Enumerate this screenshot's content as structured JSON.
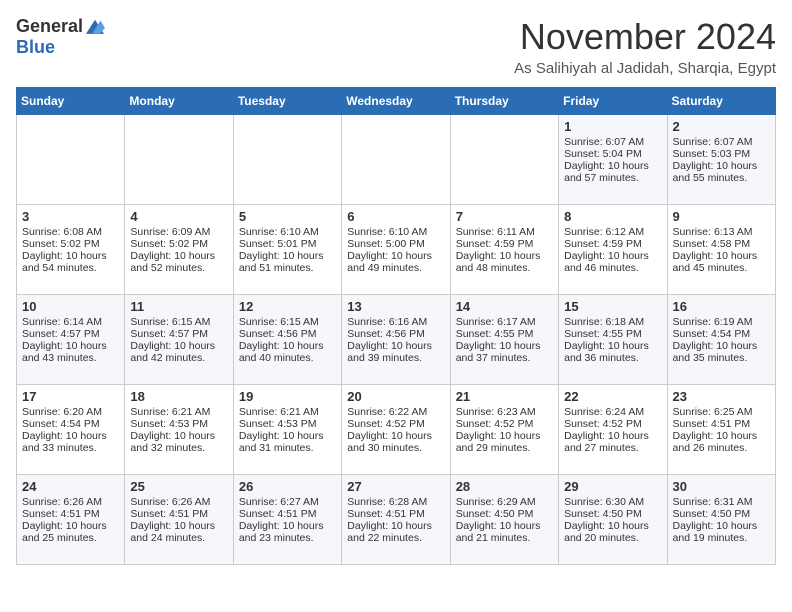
{
  "header": {
    "logo_general": "General",
    "logo_blue": "Blue",
    "month": "November 2024",
    "location": "As Salihiyah al Jadidah, Sharqia, Egypt"
  },
  "days_of_week": [
    "Sunday",
    "Monday",
    "Tuesday",
    "Wednesday",
    "Thursday",
    "Friday",
    "Saturday"
  ],
  "weeks": [
    [
      {
        "day": "",
        "info": ""
      },
      {
        "day": "",
        "info": ""
      },
      {
        "day": "",
        "info": ""
      },
      {
        "day": "",
        "info": ""
      },
      {
        "day": "",
        "info": ""
      },
      {
        "day": "1",
        "info": "Sunrise: 6:07 AM\nSunset: 5:04 PM\nDaylight: 10 hours and 57 minutes."
      },
      {
        "day": "2",
        "info": "Sunrise: 6:07 AM\nSunset: 5:03 PM\nDaylight: 10 hours and 55 minutes."
      }
    ],
    [
      {
        "day": "3",
        "info": "Sunrise: 6:08 AM\nSunset: 5:02 PM\nDaylight: 10 hours and 54 minutes."
      },
      {
        "day": "4",
        "info": "Sunrise: 6:09 AM\nSunset: 5:02 PM\nDaylight: 10 hours and 52 minutes."
      },
      {
        "day": "5",
        "info": "Sunrise: 6:10 AM\nSunset: 5:01 PM\nDaylight: 10 hours and 51 minutes."
      },
      {
        "day": "6",
        "info": "Sunrise: 6:10 AM\nSunset: 5:00 PM\nDaylight: 10 hours and 49 minutes."
      },
      {
        "day": "7",
        "info": "Sunrise: 6:11 AM\nSunset: 4:59 PM\nDaylight: 10 hours and 48 minutes."
      },
      {
        "day": "8",
        "info": "Sunrise: 6:12 AM\nSunset: 4:59 PM\nDaylight: 10 hours and 46 minutes."
      },
      {
        "day": "9",
        "info": "Sunrise: 6:13 AM\nSunset: 4:58 PM\nDaylight: 10 hours and 45 minutes."
      }
    ],
    [
      {
        "day": "10",
        "info": "Sunrise: 6:14 AM\nSunset: 4:57 PM\nDaylight: 10 hours and 43 minutes."
      },
      {
        "day": "11",
        "info": "Sunrise: 6:15 AM\nSunset: 4:57 PM\nDaylight: 10 hours and 42 minutes."
      },
      {
        "day": "12",
        "info": "Sunrise: 6:15 AM\nSunset: 4:56 PM\nDaylight: 10 hours and 40 minutes."
      },
      {
        "day": "13",
        "info": "Sunrise: 6:16 AM\nSunset: 4:56 PM\nDaylight: 10 hours and 39 minutes."
      },
      {
        "day": "14",
        "info": "Sunrise: 6:17 AM\nSunset: 4:55 PM\nDaylight: 10 hours and 37 minutes."
      },
      {
        "day": "15",
        "info": "Sunrise: 6:18 AM\nSunset: 4:55 PM\nDaylight: 10 hours and 36 minutes."
      },
      {
        "day": "16",
        "info": "Sunrise: 6:19 AM\nSunset: 4:54 PM\nDaylight: 10 hours and 35 minutes."
      }
    ],
    [
      {
        "day": "17",
        "info": "Sunrise: 6:20 AM\nSunset: 4:54 PM\nDaylight: 10 hours and 33 minutes."
      },
      {
        "day": "18",
        "info": "Sunrise: 6:21 AM\nSunset: 4:53 PM\nDaylight: 10 hours and 32 minutes."
      },
      {
        "day": "19",
        "info": "Sunrise: 6:21 AM\nSunset: 4:53 PM\nDaylight: 10 hours and 31 minutes."
      },
      {
        "day": "20",
        "info": "Sunrise: 6:22 AM\nSunset: 4:52 PM\nDaylight: 10 hours and 30 minutes."
      },
      {
        "day": "21",
        "info": "Sunrise: 6:23 AM\nSunset: 4:52 PM\nDaylight: 10 hours and 29 minutes."
      },
      {
        "day": "22",
        "info": "Sunrise: 6:24 AM\nSunset: 4:52 PM\nDaylight: 10 hours and 27 minutes."
      },
      {
        "day": "23",
        "info": "Sunrise: 6:25 AM\nSunset: 4:51 PM\nDaylight: 10 hours and 26 minutes."
      }
    ],
    [
      {
        "day": "24",
        "info": "Sunrise: 6:26 AM\nSunset: 4:51 PM\nDaylight: 10 hours and 25 minutes."
      },
      {
        "day": "25",
        "info": "Sunrise: 6:26 AM\nSunset: 4:51 PM\nDaylight: 10 hours and 24 minutes."
      },
      {
        "day": "26",
        "info": "Sunrise: 6:27 AM\nSunset: 4:51 PM\nDaylight: 10 hours and 23 minutes."
      },
      {
        "day": "27",
        "info": "Sunrise: 6:28 AM\nSunset: 4:51 PM\nDaylight: 10 hours and 22 minutes."
      },
      {
        "day": "28",
        "info": "Sunrise: 6:29 AM\nSunset: 4:50 PM\nDaylight: 10 hours and 21 minutes."
      },
      {
        "day": "29",
        "info": "Sunrise: 6:30 AM\nSunset: 4:50 PM\nDaylight: 10 hours and 20 minutes."
      },
      {
        "day": "30",
        "info": "Sunrise: 6:31 AM\nSunset: 4:50 PM\nDaylight: 10 hours and 19 minutes."
      }
    ]
  ]
}
